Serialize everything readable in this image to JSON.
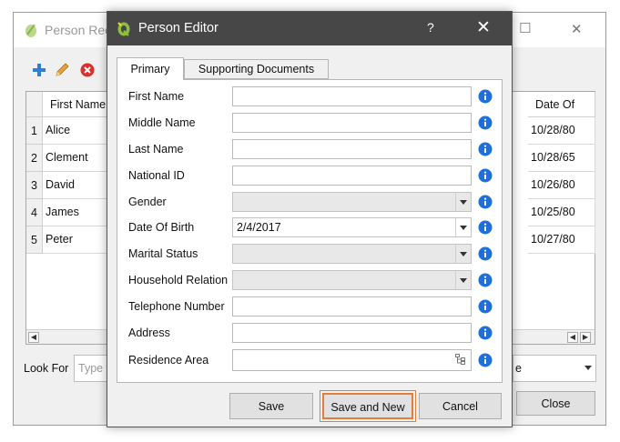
{
  "background_window": {
    "title": "Person Rec",
    "minimize_glyph": "─",
    "maximize_glyph": "☐",
    "close_glyph": "✕",
    "toolbar": {
      "add_icon": "plus-icon",
      "edit_icon": "pencil-icon",
      "delete_icon": "delete-icon"
    },
    "table": {
      "columns": [
        {
          "label": "First Name"
        },
        {
          "label": "Date Of"
        }
      ],
      "rows": [
        {
          "num": "1",
          "first_name": "Alice",
          "date": "10/28/80"
        },
        {
          "num": "2",
          "first_name": "Clement",
          "date": "10/28/65"
        },
        {
          "num": "3",
          "first_name": "David",
          "date": "10/26/80"
        },
        {
          "num": "4",
          "first_name": "James",
          "date": "10/25/80"
        },
        {
          "num": "5",
          "first_name": "Peter",
          "date": "10/27/80"
        }
      ]
    },
    "look_for_label": "Look For",
    "look_for_placeholder": "Type t",
    "combo_value": "e",
    "close_button": "Close"
  },
  "dialog": {
    "title": "Person Editor",
    "help_glyph": "?",
    "close_glyph": "✕",
    "tabs": [
      {
        "label": "Primary",
        "active": true
      },
      {
        "label": "Supporting Documents",
        "active": false
      }
    ],
    "fields": [
      {
        "label": "First Name",
        "type": "text",
        "value": ""
      },
      {
        "label": "Middle Name",
        "type": "text",
        "value": ""
      },
      {
        "label": "Last Name",
        "type": "text",
        "value": ""
      },
      {
        "label": "National ID",
        "type": "text",
        "value": ""
      },
      {
        "label": "Gender",
        "type": "combo",
        "value": ""
      },
      {
        "label": "Date Of Birth",
        "type": "combo",
        "value": "2/4/2017"
      },
      {
        "label": "Marital Status",
        "type": "combo",
        "value": ""
      },
      {
        "label": "Household Relation",
        "type": "combo",
        "value": ""
      },
      {
        "label": "Telephone Number",
        "type": "text",
        "value": ""
      },
      {
        "label": "Address",
        "type": "text",
        "value": ""
      },
      {
        "label": "Residence Area",
        "type": "tree",
        "value": ""
      }
    ],
    "buttons": {
      "save": "Save",
      "save_and_new": "Save and New",
      "cancel": "Cancel"
    },
    "colors": {
      "titlebar": "#474747",
      "info_icon": "#1e6fd9",
      "highlight": "#e27d3a"
    }
  }
}
